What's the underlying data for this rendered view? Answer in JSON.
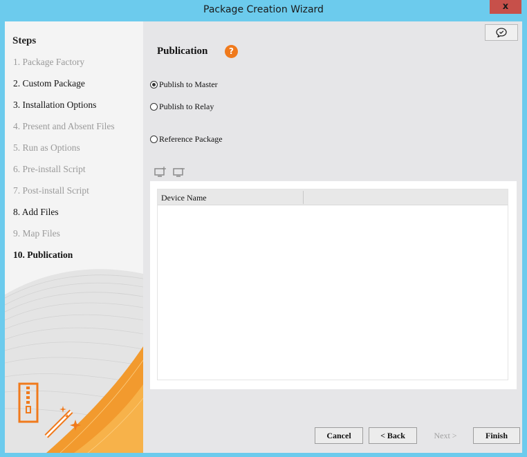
{
  "window": {
    "title": "Package Creation Wizard",
    "close_label": "x"
  },
  "sidebar": {
    "title": "Steps",
    "steps": [
      {
        "label": "1. Package Factory",
        "state": "disabled"
      },
      {
        "label": "2. Custom Package",
        "state": "done"
      },
      {
        "label": "3. Installation Options",
        "state": "done"
      },
      {
        "label": "4. Present and Absent Files",
        "state": "disabled"
      },
      {
        "label": "5. Run as Options",
        "state": "disabled"
      },
      {
        "label": "6. Pre-install Script",
        "state": "disabled"
      },
      {
        "label": "7. Post-install Script",
        "state": "disabled"
      },
      {
        "label": "8. Add Files",
        "state": "done"
      },
      {
        "label": "9. Map Files",
        "state": "disabled"
      },
      {
        "label": "10. Publication",
        "state": "current"
      }
    ]
  },
  "main": {
    "title": "Publication",
    "help_label": "?",
    "options": [
      {
        "label": "Publish to Master",
        "checked": true
      },
      {
        "label": "Publish to Relay",
        "checked": false
      },
      {
        "label": "Reference Package",
        "checked": false
      }
    ],
    "toolbar": {
      "add_icon": "add-device-icon",
      "remove_icon": "remove-device-icon"
    },
    "grid": {
      "columns": [
        "Device Name",
        ""
      ],
      "rows": []
    }
  },
  "footer": {
    "cancel_label": "Cancel",
    "back_label": "< Back",
    "next_label": "Next >",
    "finish_label": "Finish"
  },
  "colors": {
    "accent": "#f07a1c",
    "titlebar": "#6ccbed",
    "close": "#c7504a"
  }
}
